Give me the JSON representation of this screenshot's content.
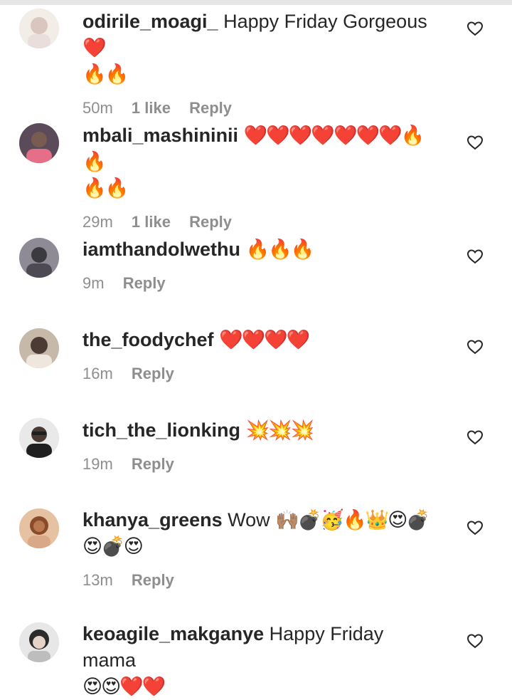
{
  "comments": [
    {
      "username": "odirile_moagi_",
      "text": "Happy Friday Gorgeous",
      "emoji_line1": "❤️",
      "emoji_line2": "🔥🔥",
      "time": "50m",
      "likes": "1 like",
      "reply": "Reply",
      "avatar_colors": [
        "#d9c6bf",
        "#f3ede8"
      ]
    },
    {
      "username": "mbali_mashininii",
      "text": "",
      "emoji_line1": "❤️❤️❤️❤️❤️❤️❤️🔥🔥",
      "emoji_line2": "🔥🔥",
      "time": "29m",
      "likes": "1 like",
      "reply": "Reply",
      "avatar_colors": [
        "#5a4a5a",
        "#e56f88"
      ]
    },
    {
      "username": "iamthandolwethu",
      "text": "",
      "emoji_line1": "🔥🔥🔥",
      "emoji_line2": "",
      "time": "9m",
      "likes": "",
      "reply": "Reply",
      "avatar_colors": [
        "#3b3a3f",
        "#8f8b96"
      ]
    },
    {
      "username": "the_foodychef",
      "text": "",
      "emoji_line1": "❤️❤️❤️❤️",
      "emoji_line2": "",
      "time": "16m",
      "likes": "",
      "reply": "Reply",
      "avatar_colors": [
        "#4b3b34",
        "#c7b9aa"
      ]
    },
    {
      "username": "tich_the_lionking",
      "text": "",
      "emoji_line1": "💥💥💥",
      "emoji_line2": "",
      "time": "19m",
      "likes": "",
      "reply": "Reply",
      "avatar_colors": [
        "#1f1f1f",
        "#e9e9e9"
      ]
    },
    {
      "username": "khanya_greens",
      "text": "Wow",
      "emoji_line1": "🙌🏽💣🥳🔥👑😍💣",
      "emoji_line2": "😍💣😍",
      "time": "13m",
      "likes": "",
      "reply": "Reply",
      "avatar_colors": [
        "#8a4b2a",
        "#e6c2a3"
      ]
    },
    {
      "username": "keoagile_makganye",
      "text": "Happy Friday mama",
      "emoji_line1": "",
      "emoji_line2": "😍😍❤️❤️",
      "time": "",
      "likes": "",
      "reply": "",
      "avatar_colors": [
        "#2b2b2b",
        "#e7e7e7"
      ]
    }
  ]
}
